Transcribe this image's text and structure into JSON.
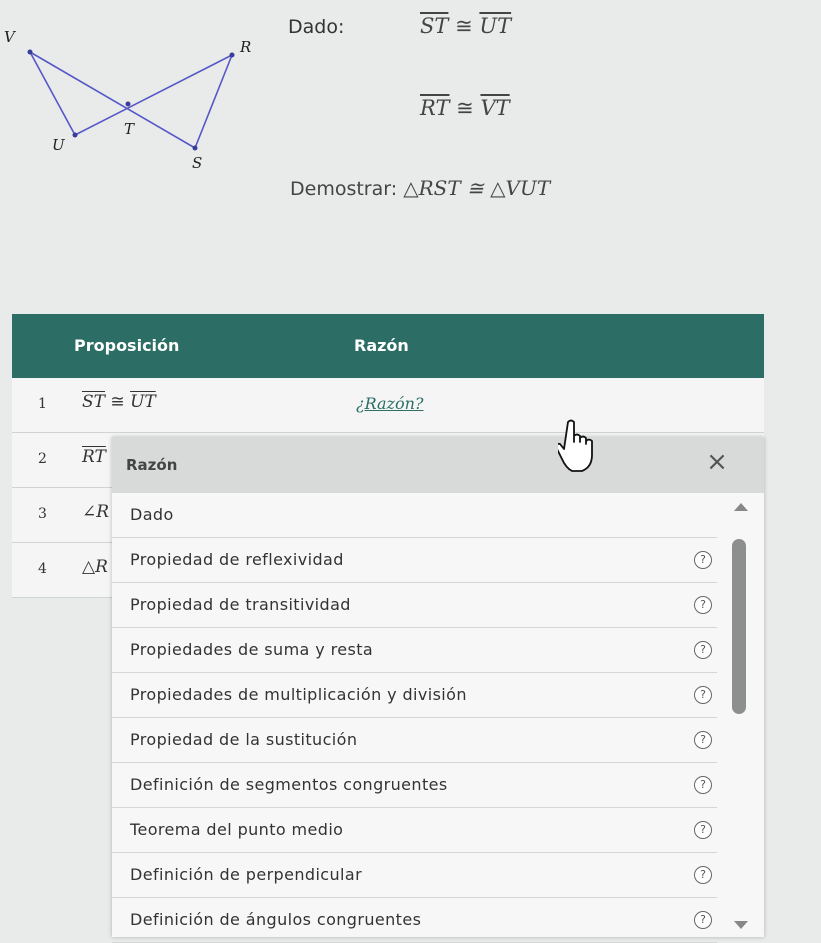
{
  "figure": {
    "labels": {
      "V": "V",
      "R": "R",
      "T": "T",
      "U": "U",
      "S": "S"
    }
  },
  "given": {
    "label": "Dado:",
    "line1": {
      "left": "ST",
      "symbol": "≅",
      "right": "UT"
    },
    "line2": {
      "left": "RT",
      "symbol": "≅",
      "right": "VT"
    }
  },
  "prove": {
    "label": "Demostrar:",
    "statement": "△RST ≅ △VUT"
  },
  "table": {
    "headers": {
      "statement": "Proposición",
      "reason": "Razón"
    },
    "rows": [
      {
        "num": "1",
        "stmt_left": "ST",
        "symbol": "≅",
        "stmt_right": "UT",
        "reason": "¿Razón?"
      },
      {
        "num": "2",
        "stmt": "RT"
      },
      {
        "num": "3",
        "stmt": "∠R"
      },
      {
        "num": "4",
        "stmt": "△R"
      }
    ]
  },
  "dropdown": {
    "title": "Razón",
    "close": "×",
    "help_glyph": "?",
    "items": [
      "Dado",
      "Propiedad de reflexividad",
      "Propiedad de transitividad",
      "Propiedades de suma y resta",
      "Propiedades de multiplicación y división",
      "Propiedad de la sustitución",
      "Definición de segmentos congruentes",
      "Teorema del punto medio",
      "Definición de perpendicular",
      "Definición de ángulos congruentes"
    ]
  },
  "colors": {
    "header": "#2c6e65",
    "accent": "#2c6e65"
  }
}
